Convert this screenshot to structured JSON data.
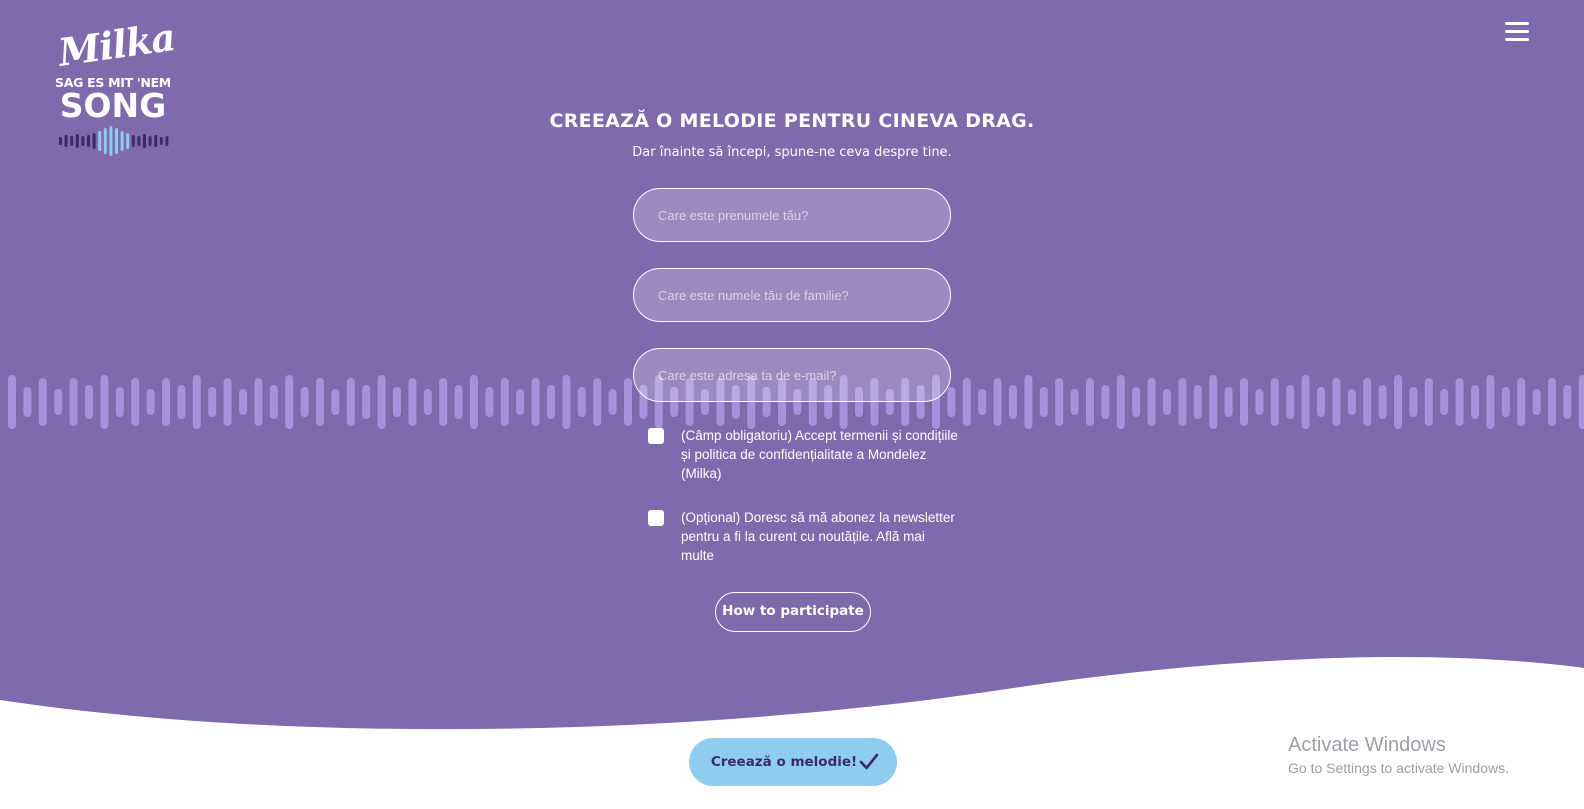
{
  "logo": {
    "brand": "Milka",
    "tagline": "SAG ES MIT 'NEM",
    "song": "SONG"
  },
  "header": {
    "menu_icon": "hamburger-menu-icon"
  },
  "form": {
    "title": "CREEAZĂ O MELODIE PENTRU CINEVA DRAG.",
    "subtitle": "Dar înainte să începi, spune-ne ceva despre tine.",
    "first_name_placeholder": "Care este prenumele tău?",
    "last_name_placeholder": "Care este numele tău de familie?",
    "email_placeholder": "Care este adresa ta de e-mail?",
    "terms_checkbox_label": "(Câmp obligatoriu) Accept termenii și condițiile și politica de confidențialitate a Mondelez (Milka)",
    "newsletter_checkbox_label": "(Opțional) Doresc să mă abonez la newsletter pentru a fi la curent cu noutățile. Află mai multe",
    "how_to_participate": "How to participate",
    "create_button": "Creează o melodie!",
    "create_icon": "check-icon"
  },
  "os_watermark": {
    "title": "Activate Windows",
    "message": "Go to Settings to activate Windows."
  },
  "colors": {
    "background_purple": "#7e6aad",
    "wave_bars": "#a592dc",
    "button_blue": "#8fcdee",
    "button_text": "#3b2a66"
  }
}
